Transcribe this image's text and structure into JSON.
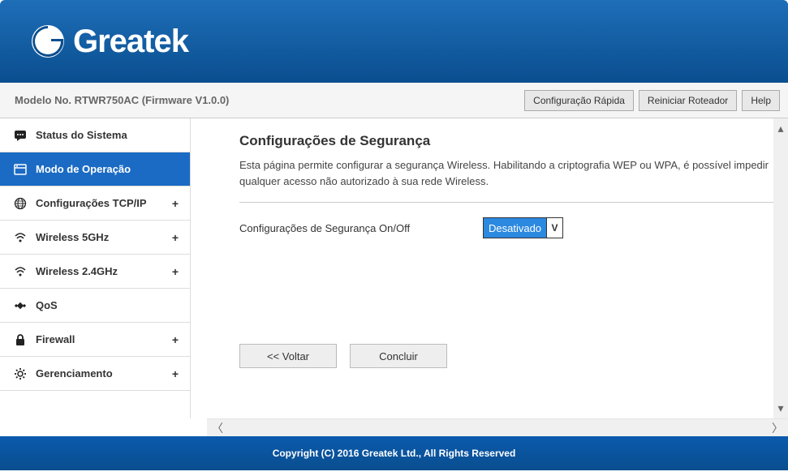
{
  "brand": "Greatek",
  "model_info": "Modelo No. RTWR750AC (Firmware V1.0.0)",
  "top_buttons": {
    "quick_config": "Configuração Rápida",
    "restart_router": "Reiniciar Roteador",
    "help": "Help"
  },
  "sidebar": {
    "items": [
      {
        "label": "Status do Sistema",
        "icon": "chat-icon",
        "expandable": false
      },
      {
        "label": "Modo de Operação",
        "icon": "window-icon",
        "expandable": false
      },
      {
        "label": "Configurações TCP/IP",
        "icon": "globe-icon",
        "expandable": true
      },
      {
        "label": "Wireless 5GHz",
        "icon": "wifi-icon",
        "expandable": true
      },
      {
        "label": "Wireless 2.4GHz",
        "icon": "wifi-icon",
        "expandable": true
      },
      {
        "label": "QoS",
        "icon": "diamond-icon",
        "expandable": false
      },
      {
        "label": "Firewall",
        "icon": "lock-icon",
        "expandable": true
      },
      {
        "label": "Gerenciamento",
        "icon": "gear-icon",
        "expandable": true
      }
    ]
  },
  "content": {
    "title": "Configurações de Segurança",
    "description": "Esta página permite configurar a segurança Wireless. Habilitando a criptografia WEP ou WPA, é possível impedir qualquer acesso não autorizado à sua rede Wireless.",
    "field_label": "Configurações de Segurança On/Off",
    "select_value": "Desativado",
    "buttons": {
      "back": "<< Voltar",
      "finish": "Concluir"
    }
  },
  "footer": "Copyright (C) 2016 Greatek Ltd., All Rights Reserved",
  "expand_symbol": "+"
}
